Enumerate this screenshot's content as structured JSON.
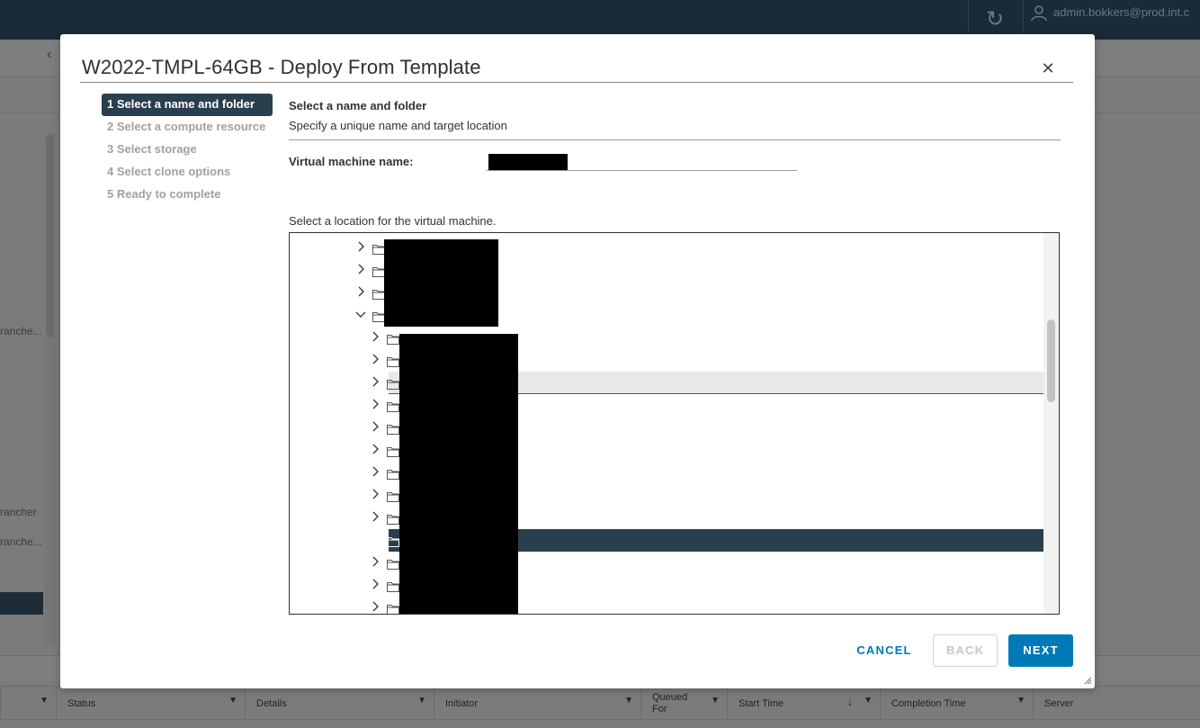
{
  "app": {
    "user_label": "admin.bokkers@prod.int.c",
    "refresh_icon": "refresh-icon",
    "left_labels": [
      "ranche...",
      "rancher",
      "ranche..."
    ],
    "table_columns": [
      "Status",
      "Details",
      "Initiator",
      "Queued For",
      "Start Time",
      "Completion Time",
      "Server"
    ]
  },
  "dialog": {
    "title": "W2022-TMPL-64GB - Deploy From Template",
    "close_icon": "close-icon",
    "steps": [
      "1 Select a name and folder",
      "2 Select a compute resource",
      "3 Select storage",
      "4 Select clone options",
      "5 Ready to complete"
    ],
    "active_step": 0,
    "section_title": "Select a name and folder",
    "section_desc": "Specify a unique name and target location",
    "vm_name_label": "Virtual machine name:",
    "vm_name_value": "",
    "location_label": "Select a location for the virtual machine.",
    "tree": [
      {
        "level": 0,
        "expanded": false,
        "label": ""
      },
      {
        "level": 0,
        "expanded": false,
        "label": ""
      },
      {
        "level": 0,
        "expanded": false,
        "label": ""
      },
      {
        "level": 0,
        "expanded": true,
        "label": ""
      },
      {
        "level": 1,
        "expanded": false,
        "label": ""
      },
      {
        "level": 1,
        "expanded": false,
        "label": ""
      },
      {
        "level": 1,
        "expanded": false,
        "label": "",
        "state": "hover"
      },
      {
        "level": 1,
        "expanded": false,
        "label": ""
      },
      {
        "level": 1,
        "expanded": false,
        "label": ""
      },
      {
        "level": 1,
        "expanded": false,
        "label": ""
      },
      {
        "level": 1,
        "expanded": false,
        "label": ""
      },
      {
        "level": 1,
        "expanded": false,
        "label": ""
      },
      {
        "level": 1,
        "expanded": false,
        "label": ""
      },
      {
        "level": 1,
        "leaf": true,
        "label": "",
        "state": "selected"
      },
      {
        "level": 1,
        "expanded": false,
        "label": ""
      },
      {
        "level": 1,
        "expanded": false,
        "label": ""
      },
      {
        "level": 1,
        "expanded": false,
        "label": ""
      }
    ],
    "buttons": {
      "cancel": "CANCEL",
      "back": "BACK",
      "next": "NEXT"
    },
    "colors": {
      "primary": "#0079b8",
      "active_step_bg": "#2a3f4e",
      "selected_row_bg": "#2a3f4e"
    }
  }
}
